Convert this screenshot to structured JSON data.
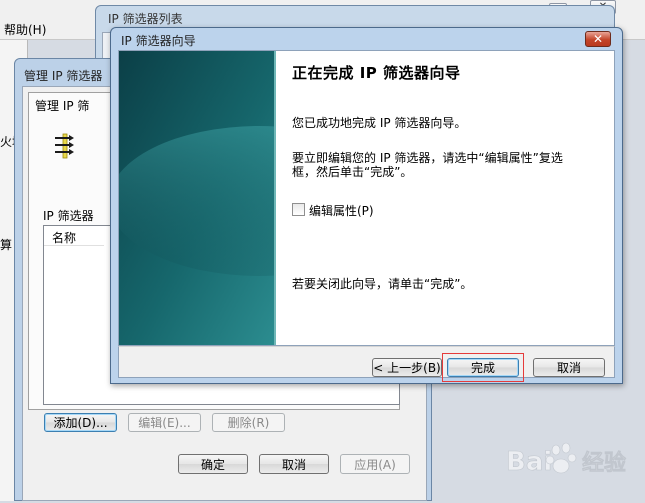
{
  "main_window": {
    "menu_help": "帮助(H)",
    "frag_fire": "火墙",
    "frag_calc": "算",
    "window_icons": [
      "minimize-icon",
      "close-icon"
    ]
  },
  "list_dialog": {
    "title": "IP 筛选器列表"
  },
  "manage_dialog": {
    "title": "管理 IP 筛选器",
    "tab_label": "管理 IP 筛",
    "group_label": "IP 筛选器",
    "column_name": "名称",
    "add_button": "添加(D)...",
    "edit_button": "编辑(E)...",
    "remove_button": "删除(R)",
    "ok_button": "确定",
    "cancel_button": "取消",
    "apply_button": "应用(A)"
  },
  "wizard": {
    "title": "IP 筛选器向导",
    "close_icon": "close-icon",
    "heading": "正在完成 IP 筛选器向导",
    "success_text": "您已成功地完成 IP 筛选器向导。",
    "edit_instruction_line1": "要立即编辑您的 IP 筛选器，请选中“编辑属性”复选",
    "edit_instruction_line2": "框，然后单击“完成”。",
    "checkbox_label": "编辑属性(P)",
    "checkbox_checked": false,
    "close_instruction": "若要关闭此向导，请单击“完成”。",
    "back_button": "< 上一步(B)",
    "finish_button": "完成",
    "cancel_button": "取消"
  },
  "watermark": {
    "brand": "Bai",
    "brand2": "经验"
  },
  "colors": {
    "highlight": "#e53b3b",
    "wizard_panel_dark": "#0d4a52",
    "wizard_panel_light": "#2f8b8e"
  }
}
